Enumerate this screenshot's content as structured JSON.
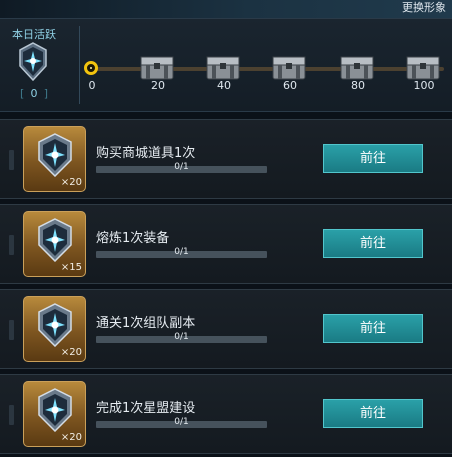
{
  "header": {
    "change_look": "更换形象"
  },
  "activity": {
    "title": "本日活跃",
    "count": "0",
    "milestones": [
      "0",
      "20",
      "40",
      "60",
      "80",
      "100"
    ]
  },
  "tasks": [
    {
      "name": "购买商城道具1次",
      "progress": "0/1",
      "reward_count": "×20",
      "button": "前往"
    },
    {
      "name": "熔炼1次装备",
      "progress": "0/1",
      "reward_count": "×15",
      "button": "前往"
    },
    {
      "name": "通关1次组队副本",
      "progress": "0/1",
      "reward_count": "×20",
      "button": "前往"
    },
    {
      "name": "完成1次星盟建设",
      "progress": "0/1",
      "reward_count": "×20",
      "button": "前往"
    }
  ],
  "icons": {
    "activity_badge": "activity-badge-icon",
    "chest": "treasure-chest-icon",
    "reward": "activity-badge-icon"
  },
  "colors": {
    "button": "#1f8a93",
    "knob": "#f2c30e",
    "reward_card": "#8a6024"
  }
}
